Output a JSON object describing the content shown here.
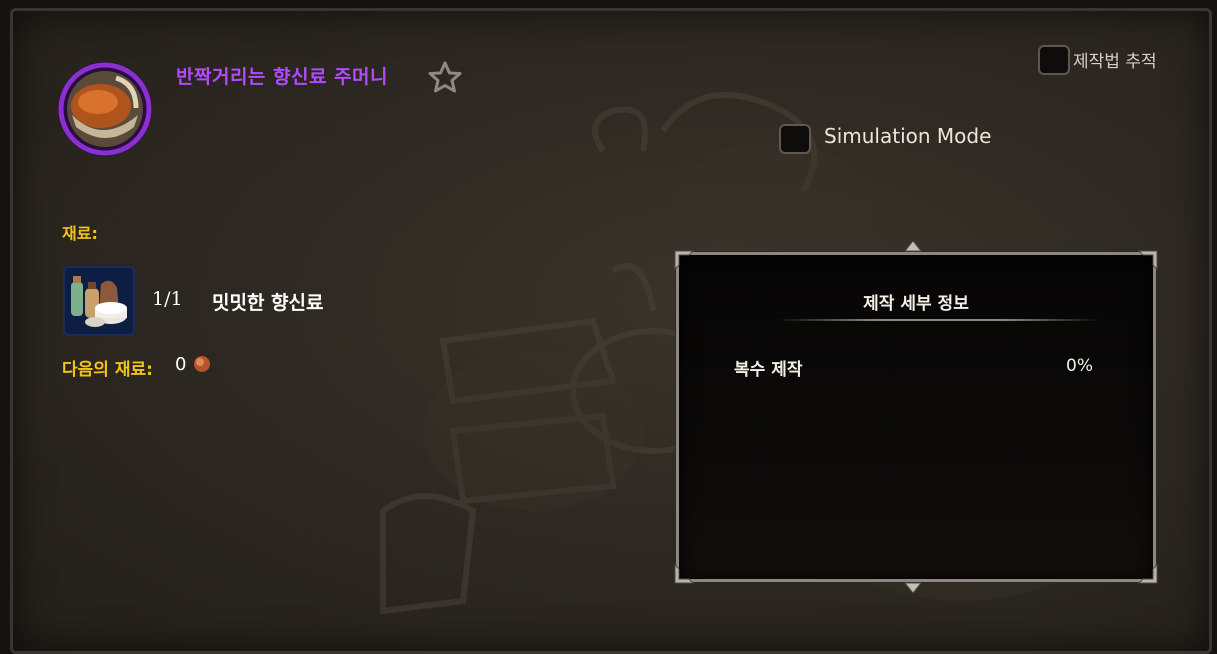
{
  "recipe": {
    "name": "반짝거리는 향신료 주머니",
    "quality_color": "#b24bff",
    "icon": "spice-bowl-icon"
  },
  "favorite_icon": "star-outline-icon",
  "track_recipe": {
    "label": "제작법 추적",
    "checked": false
  },
  "simulation_mode": {
    "label": "Simulation Mode",
    "checked": false
  },
  "reagents": {
    "title": "재료:",
    "items": [
      {
        "count": "1/1",
        "name": "밋밋한 향신료",
        "icon": "spice-jars-icon"
      }
    ]
  },
  "finishing_reagents": {
    "label": "다음의 재료:",
    "value": "0",
    "icon": "copper-coin-icon"
  },
  "details": {
    "title": "제작 세부 정보",
    "stats": [
      {
        "label": "복수 제작",
        "value": "0%"
      }
    ]
  },
  "colors": {
    "gold_label": "#f2c31a",
    "epic_purple": "#b24bff",
    "panel_border": "#8b8880"
  }
}
